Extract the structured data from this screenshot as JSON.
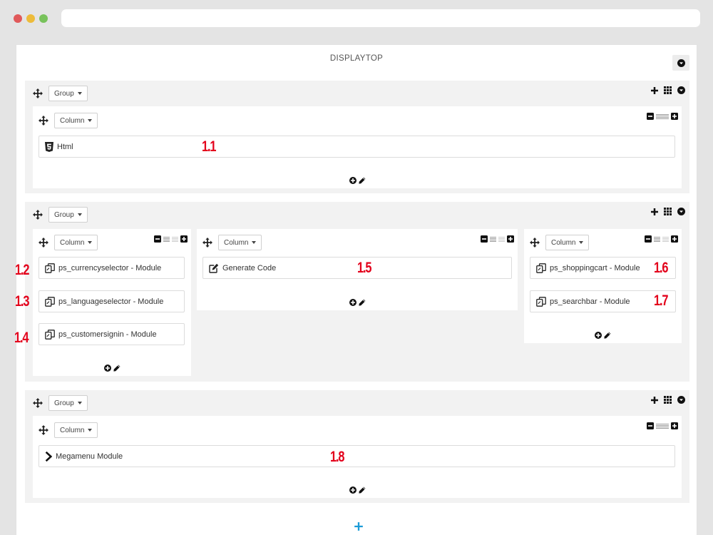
{
  "hook": {
    "title": "DISPLAYTOP"
  },
  "groups": [
    {
      "label": "Group",
      "columns": [
        {
          "label": "Column",
          "modules": [
            {
              "icon": "html5-icon",
              "label": "Html"
            }
          ]
        }
      ]
    },
    {
      "label": "Group",
      "columns": [
        {
          "label": "Column",
          "modules": [
            {
              "icon": "module-icon",
              "label": "ps_currencyselector - Module"
            },
            {
              "icon": "module-icon",
              "label": "ps_languageselector - Module"
            },
            {
              "icon": "module-icon",
              "label": "ps_customersignin - Module"
            }
          ]
        },
        {
          "label": "Column",
          "modules": [
            {
              "icon": "edit-icon",
              "label": "Generate Code"
            }
          ]
        },
        {
          "label": "Column",
          "modules": [
            {
              "icon": "module-icon",
              "label": "ps_shoppingcart - Module"
            },
            {
              "icon": "module-icon",
              "label": "ps_searchbar - Module"
            }
          ]
        }
      ]
    },
    {
      "label": "Group",
      "columns": [
        {
          "label": "Column",
          "modules": [
            {
              "icon": "chevron-right-icon",
              "label": "Megamenu Module"
            }
          ]
        }
      ]
    }
  ],
  "annotations": [
    "1.1",
    "1.2",
    "1.3",
    "1.4",
    "1.5",
    "1.6",
    "1.7",
    "1.8"
  ],
  "colors": {
    "annotation": "#e3001b",
    "add_group": "#1b9bd7",
    "group_bg": "#f2f2f2"
  }
}
